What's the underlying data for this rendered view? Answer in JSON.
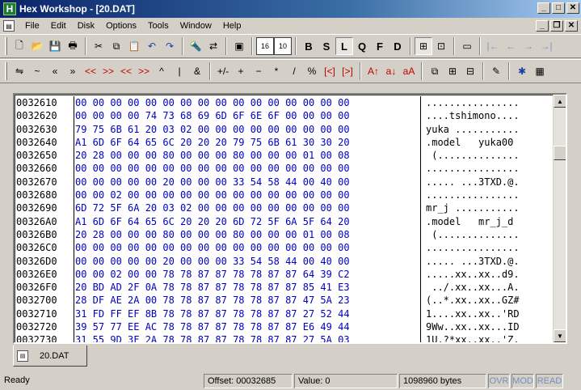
{
  "window": {
    "title": "Hex Workshop - [20.DAT]",
    "app_icon_letter": "H"
  },
  "menu": [
    "File",
    "Edit",
    "Disk",
    "Options",
    "Tools",
    "Window",
    "Help"
  ],
  "toolbar1": {
    "groups": [
      [
        "new-file-icon",
        "open-file-icon",
        "save-icon",
        "print-icon"
      ],
      [
        "cut-icon",
        "copy-icon",
        "paste-icon",
        "undo-icon",
        "redo-icon"
      ],
      [
        "find-icon",
        "replace-icon"
      ],
      [
        "clipboard-icon"
      ],
      [
        "base-16-icon",
        "base-10-icon"
      ],
      [
        "B",
        "S",
        "L",
        "Q",
        "F",
        "D"
      ],
      [
        "calculator-panel-icon",
        "bookmark-panel-icon"
      ],
      [
        "window-icon"
      ],
      [
        "go-start-icon",
        "go-back-icon",
        "go-forward-icon",
        "go-end-icon"
      ]
    ]
  },
  "toolbar2": {
    "items": [
      "⇋",
      "~",
      "«",
      "»",
      "<<",
      ">>",
      "<<",
      ">>",
      "^",
      "|",
      "&",
      "+/-",
      "+",
      "−",
      "*",
      "/",
      "%",
      "[<]",
      "[>]",
      "A↑",
      "a↓",
      "aA",
      "compare-icon",
      "checksum-icon",
      "structure-icon",
      "properties-icon",
      "chip-icon",
      "calc-icon"
    ]
  },
  "hexview": {
    "rows": [
      {
        "addr": "0032610",
        "hex": "00 00 00 00 00 00 00 00 00 00 00 00 00 00 00 00",
        "ascii": "................"
      },
      {
        "addr": "0032620",
        "hex": "00 00 00 00 74 73 68 69 6D 6F 6E 6F 00 00 00 00",
        "ascii": "....tshimono...."
      },
      {
        "addr": "0032630",
        "hex": "79 75 6B 61 20 03 02 00 00 00 00 00 00 00 00 00",
        "ascii": "yuka ..........."
      },
      {
        "addr": "0032640",
        "hex": "A1 6D 6F 64 65 6C 20 20 20 79 75 6B 61 30 30 20",
        "ascii": ".model   yuka00 "
      },
      {
        "addr": "0032650",
        "hex": "20 28 00 00 00 80 00 00 00 80 00 00 00 01 00 08",
        "ascii": " (.............."
      },
      {
        "addr": "0032660",
        "hex": "00 00 00 00 00 00 00 00 00 00 00 00 00 00 00 00",
        "ascii": "................"
      },
      {
        "addr": "0032670",
        "hex": "00 00 00 00 00 20 00 00 00 33 54 58 44 00 40 00",
        "ascii": "..... ...3TXD.@."
      },
      {
        "addr": "0032680",
        "hex": "00 00 02 00 00 00 00 00 00 00 00 00 00 00 00 00",
        "ascii": "................"
      },
      {
        "addr": "0032690",
        "hex": "6D 72 5F 6A 20 03 02 00 00 00 00 00 00 00 00 00",
        "ascii": "mr_j ..........."
      },
      {
        "addr": "00326A0",
        "hex": "A1 6D 6F 64 65 6C 20 20 20 6D 72 5F 6A 5F 64 20",
        "ascii": ".model   mr_j_d "
      },
      {
        "addr": "00326B0",
        "hex": "20 28 00 00 00 80 00 00 00 80 00 00 00 01 00 08",
        "ascii": " (.............."
      },
      {
        "addr": "00326C0",
        "hex": "00 00 00 00 00 00 00 00 00 00 00 00 00 00 00 00",
        "ascii": "................"
      },
      {
        "addr": "00326D0",
        "hex": "00 00 00 00 00 20 00 00 00 33 54 58 44 00 40 00",
        "ascii": "..... ...3TXD.@."
      },
      {
        "addr": "00326E0",
        "hex": "00 00 02 00 00 78 78 87 87 78 78 87 87 64 39 C2",
        "ascii": ".....xx..xx..d9."
      },
      {
        "addr": "00326F0",
        "hex": "20 BD AD 2F 0A 78 78 87 87 78 78 87 87 85 41 E3",
        "ascii": " ../.xx..xx...A."
      },
      {
        "addr": "0032700",
        "hex": "28 DF AE 2A 00 78 78 87 87 78 78 87 87 47 5A 23",
        "ascii": "(..*.xx..xx..GZ#"
      },
      {
        "addr": "0032710",
        "hex": "31 FD FF EF 8B 78 78 87 87 78 78 87 87 27 52 44",
        "ascii": "1....xx..xx..'RD"
      },
      {
        "addr": "0032720",
        "hex": "39 57 77 EE AC 78 78 87 87 78 78 87 87 E6 49 44",
        "ascii": "9Ww..xx..xx...ID"
      },
      {
        "addr": "0032730",
        "hex": "31 55 9D 3F 2A 78 78 87 87 78 78 87 87 27 5A 03",
        "ascii": "1U.?*xx..xx..'Z."
      }
    ]
  },
  "tabs": [
    {
      "label": "20.DAT"
    }
  ],
  "status": {
    "ready": "Ready",
    "offset": "Offset: 00032685",
    "value": "Value: 0",
    "size": "1098960 bytes",
    "ovr": "OVR",
    "mod": "MOD",
    "read": "READ"
  }
}
